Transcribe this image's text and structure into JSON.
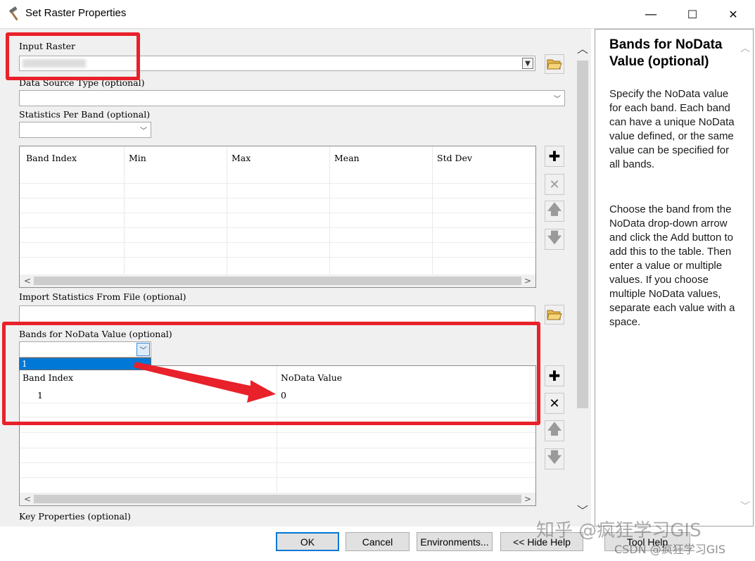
{
  "window": {
    "title": "Set Raster Properties",
    "minimize": "—",
    "maximize": "☐",
    "close": "✕"
  },
  "form": {
    "input_raster_label": "Input Raster",
    "input_raster_value": "",
    "data_source_type_label": "Data Source Type (optional)",
    "statistics_per_band_label": "Statistics Per Band (optional)",
    "stats_table_headers": [
      "Band Index",
      "Min",
      "Max",
      "Mean",
      "Std Dev"
    ],
    "import_statistics_label": "Import Statistics From File (optional)",
    "bands_nodata_label": "Bands for NoData Value (optional)",
    "bands_nodata_dropdown_option": "1",
    "nodata_table_headers": [
      "Band Index",
      "NoData Value"
    ],
    "nodata_rows": [
      {
        "band_index": "1",
        "nodata_value": "0"
      }
    ],
    "key_properties_label": "Key Properties (optional)"
  },
  "buttons": {
    "ok": "OK",
    "cancel": "Cancel",
    "environments": "Environments...",
    "hide_help": "<< Hide Help",
    "tool_help": "Tool Help"
  },
  "help": {
    "title": "Bands for NoData Value (optional)",
    "paragraph1": "Specify the NoData value for each band. Each band can have a unique NoData value defined, or the same value can be specified for all bands.",
    "paragraph2": "Choose the band from the NoData drop-down arrow and click the Add button to add this to the table. Then enter a value or multiple values. If you choose multiple NoData values, separate each value with a space."
  },
  "watermarks": {
    "zhihu": "知乎 @疯狂学习GIS",
    "csdn": "CSDN @疯狂学习GIS"
  },
  "colors": {
    "highlight_red": "#e8212a",
    "selection_blue": "#0078d7"
  }
}
